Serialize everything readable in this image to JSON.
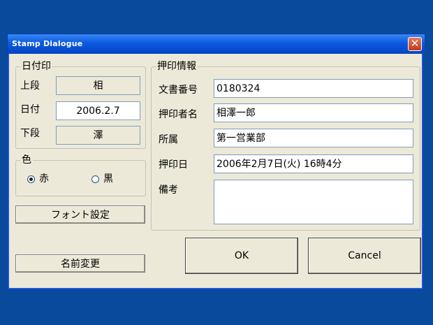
{
  "window": {
    "title": "Stamp Dialogue",
    "close_glyph": "✕"
  },
  "date_stamp": {
    "group_title": "日付印",
    "upper_label": "上段",
    "upper_value": "相",
    "date_label": "日付",
    "date_value": "2006.2.7",
    "lower_label": "下段",
    "lower_value": "澤"
  },
  "color": {
    "group_title": "色",
    "options": [
      {
        "label": "赤",
        "selected": true
      },
      {
        "label": "黒",
        "selected": false
      }
    ]
  },
  "buttons": {
    "font_settings": "フォント設定",
    "rename": "名前変更",
    "ok": "OK",
    "cancel": "Cancel"
  },
  "stamp_info": {
    "group_title": "押印情報",
    "doc_number_label": "文書番号",
    "doc_number_value": "0180324",
    "stamper_label": "押印者名",
    "stamper_value": "相澤一郎",
    "department_label": "所属",
    "department_value": "第一営業部",
    "stamp_date_label": "押印日",
    "stamp_date_value": "2006年2月7日(火) 16時4分",
    "remarks_label": "備考",
    "remarks_value": ""
  },
  "colors": {
    "desktop": "#0a4a9c",
    "dialog": "#ece9d8",
    "titlebar": "#0a5ae0"
  }
}
